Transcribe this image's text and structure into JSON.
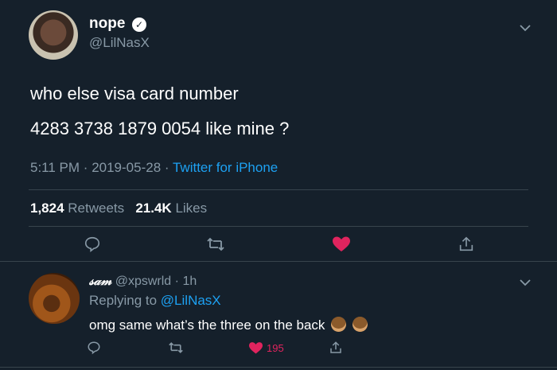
{
  "tweet": {
    "author": {
      "name": "nope",
      "handle": "@LilNasX",
      "verified": true
    },
    "lines": [
      "who else visa card number",
      "4283 3738 1879 0054 like mine ?"
    ],
    "time": "5:11 PM",
    "date": "2019-05-28",
    "source": "Twitter for iPhone",
    "retweets": "1,824",
    "retweets_label": "Retweets",
    "likes": "21.4K",
    "likes_label": "Likes",
    "liked": true
  },
  "reply": {
    "name": "𝓈𝒶𝓂",
    "handle": "@xpswrld",
    "age": "1h",
    "replying_label": "Replying to",
    "replying_to": "@LilNasX",
    "text": "omg same what’s the three on the back",
    "emoji": [
      "see-no-evil-monkey",
      "see-no-evil-monkey"
    ],
    "likes": "195",
    "liked": true
  },
  "colors": {
    "background": "#15202b",
    "secondary": "#8899a6",
    "link": "#1da1f2",
    "like": "#e0245e",
    "divider": "#38444d"
  }
}
